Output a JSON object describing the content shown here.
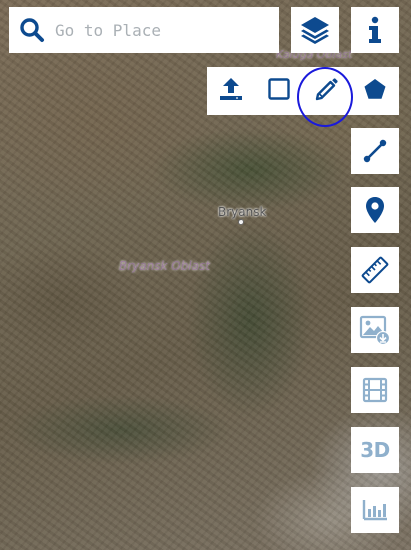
{
  "search": {
    "placeholder": "Go to Place",
    "value": ""
  },
  "map": {
    "labels": {
      "city": "Bryansk",
      "region": "Bryansk Oblast",
      "region_top": "Kaluga Oblast"
    }
  },
  "toolbar": {
    "layers_icon": "layers-icon",
    "info_icon": "info-icon"
  },
  "draw_tools": {
    "items": [
      {
        "name": "upload",
        "icon": "upload-icon"
      },
      {
        "name": "rectangle",
        "icon": "rectangle-icon"
      },
      {
        "name": "freehand",
        "icon": "pencil-icon",
        "highlighted": true
      },
      {
        "name": "polygon",
        "icon": "pentagon-icon"
      }
    ]
  },
  "side_tools": {
    "items": [
      {
        "name": "line",
        "icon": "line-icon"
      },
      {
        "name": "point",
        "icon": "map-pin-icon"
      },
      {
        "name": "measure",
        "icon": "ruler-icon"
      },
      {
        "name": "export-image",
        "icon": "image-download-icon"
      },
      {
        "name": "animation",
        "icon": "film-icon"
      },
      {
        "name": "3d",
        "icon": "3d-icon",
        "label": "3D"
      },
      {
        "name": "chart",
        "icon": "bar-chart-icon"
      }
    ]
  },
  "colors": {
    "primary": "#0d4a8f",
    "disabled": "#8fb0cc",
    "highlight_ring": "#1a1adb",
    "panel_bg": "#ffffff"
  }
}
